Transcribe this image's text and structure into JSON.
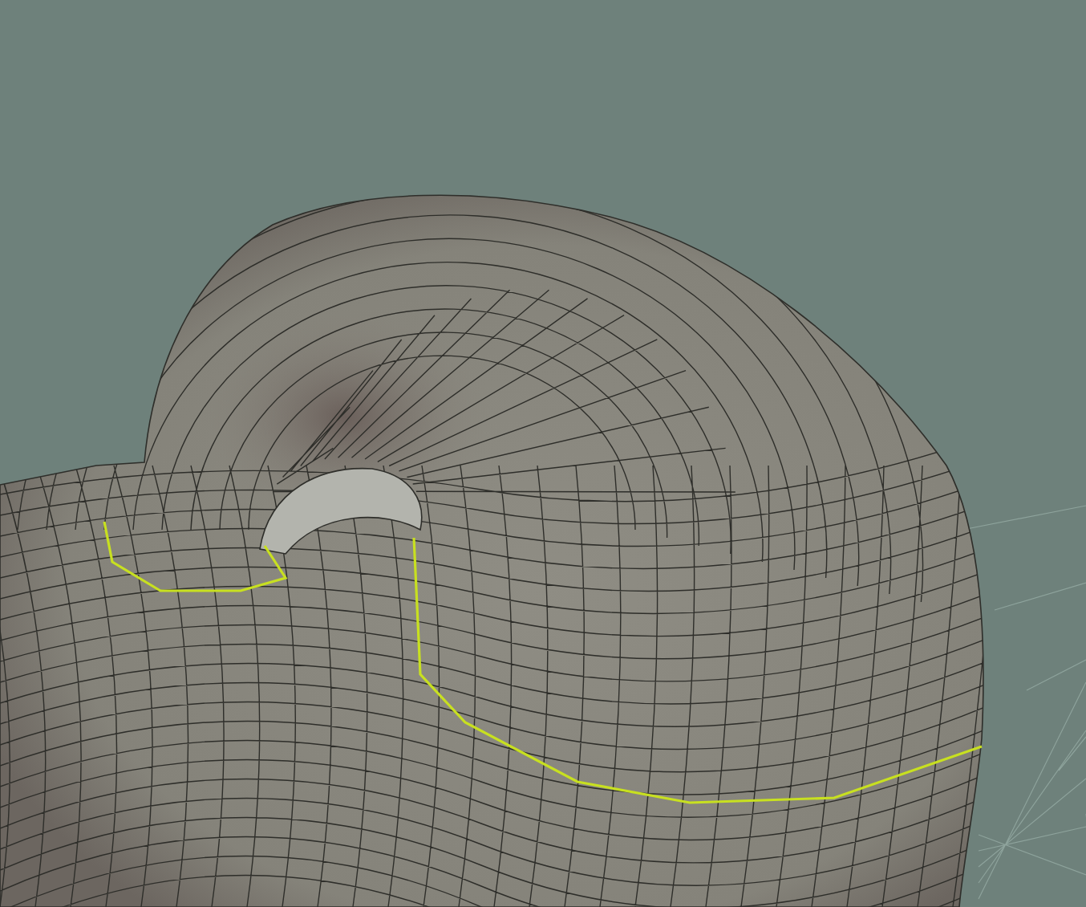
{
  "viewport": {
    "edge_selection": true
  }
}
